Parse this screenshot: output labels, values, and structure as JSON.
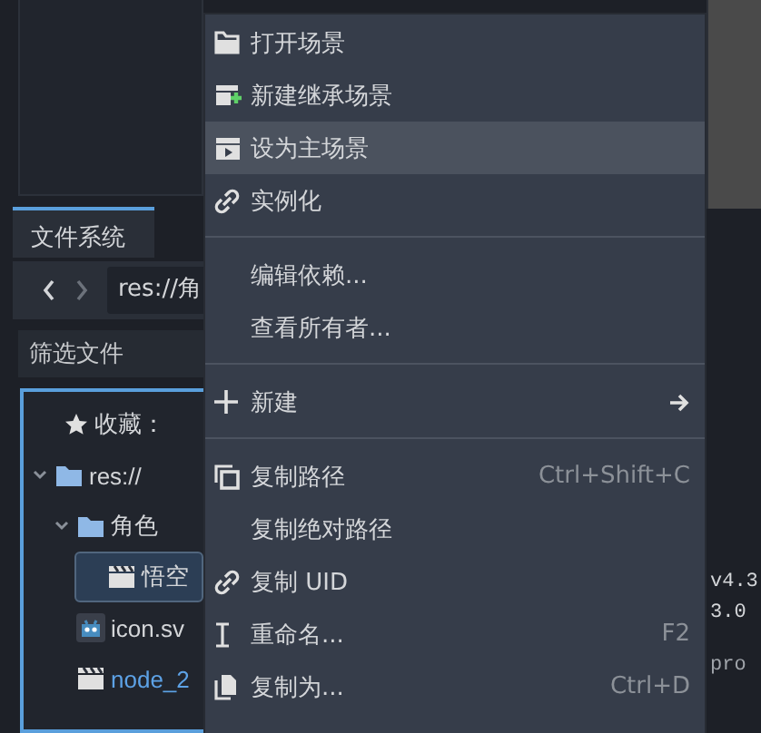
{
  "dock": {
    "tab": "文件系统",
    "path": "res://角",
    "filter_placeholder": "筛选文件",
    "tree": [
      {
        "kind": "favorites",
        "label": "收藏：",
        "selected": false,
        "current": false
      },
      {
        "kind": "folder",
        "label": "res://",
        "expanded": true,
        "selected": false,
        "current": false,
        "children": [
          {
            "kind": "folder",
            "label": "角色",
            "expanded": true,
            "selected": false,
            "current": false,
            "children": [
              {
                "kind": "scene",
                "label": "悟空",
                "selected": true,
                "current": false
              }
            ]
          },
          {
            "kind": "image",
            "label": "icon.sv",
            "selected": false,
            "current": false
          },
          {
            "kind": "scene",
            "label": "node_2",
            "selected": false,
            "current": true
          }
        ]
      }
    ]
  },
  "context_menu": [
    {
      "kind": "item",
      "label": "打开场景",
      "selected": false
    },
    {
      "kind": "item",
      "label": "新建继承场景",
      "selected": false
    },
    {
      "kind": "item",
      "label": "设为主场景",
      "selected": true
    },
    {
      "kind": "item",
      "label": "实例化",
      "selected": false
    },
    {
      "kind": "separator"
    },
    {
      "kind": "item",
      "label": "编辑依赖...",
      "selected": false
    },
    {
      "kind": "item",
      "label": "查看所有者...",
      "selected": false
    },
    {
      "kind": "separator"
    },
    {
      "kind": "submenu",
      "label": "新建",
      "selected": false
    },
    {
      "kind": "separator"
    },
    {
      "kind": "item",
      "label": "复制路径",
      "shortcut": "Ctrl+Shift+C",
      "selected": false
    },
    {
      "kind": "item",
      "label": "复制绝对路径",
      "selected": false
    },
    {
      "kind": "item",
      "label": "复制 UID",
      "selected": false
    },
    {
      "kind": "item",
      "label": "重命名...",
      "shortcut": "F2",
      "selected": false
    },
    {
      "kind": "item",
      "label": "复制为...",
      "shortcut": "Ctrl+D",
      "selected": false
    }
  ],
  "output": {
    "lines": [
      "v4.3",
      "3.0",
      "pro"
    ]
  }
}
